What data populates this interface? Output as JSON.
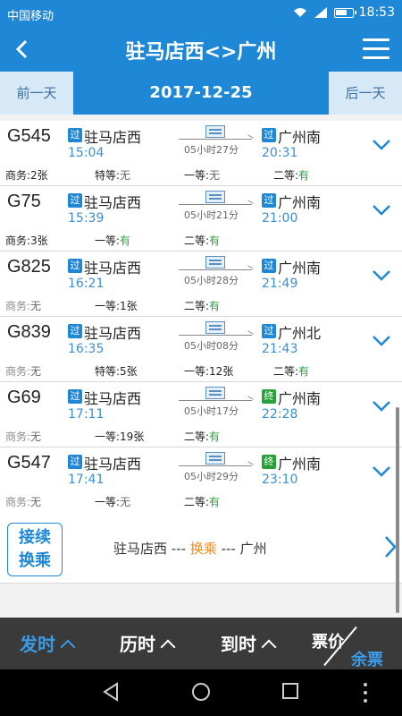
{
  "status_bar": {
    "carrier": "中国移动",
    "time": "18:53"
  },
  "header": {
    "title": "驻马店西<>广州"
  },
  "date_bar": {
    "prev_label": "前一天",
    "date": "2017-12-25",
    "next_label": "后一天"
  },
  "trains": [
    {
      "no": "G545",
      "dep_badge": "过",
      "dep_station": "驻马店西",
      "dep_time": "15:04",
      "duration": "05小时27分",
      "arr_badge": "过",
      "arr_badge_type": "pass",
      "arr_station": "广州南",
      "arr_time": "20:31",
      "seats": [
        {
          "label": "商务:",
          "value": "2张",
          "state": "count"
        },
        {
          "label": "特等:",
          "value": "无",
          "state": "none"
        },
        {
          "label": "一等:",
          "value": "无",
          "state": "none"
        },
        {
          "label": "二等:",
          "value": "有",
          "state": "avail"
        }
      ]
    },
    {
      "no": "G75",
      "dep_badge": "过",
      "dep_station": "驻马店西",
      "dep_time": "15:39",
      "duration": "05小时21分",
      "arr_badge": "过",
      "arr_badge_type": "pass",
      "arr_station": "广州南",
      "arr_time": "21:00",
      "seats": [
        {
          "label": "商务:",
          "value": "3张",
          "state": "count"
        },
        {
          "label": "一等:",
          "value": "有",
          "state": "avail"
        },
        {
          "label": "二等:",
          "value": "有",
          "state": "avail"
        },
        {
          "label": "",
          "value": "",
          "state": "none"
        }
      ]
    },
    {
      "no": "G825",
      "dep_badge": "过",
      "dep_station": "驻马店西",
      "dep_time": "16:21",
      "duration": "05小时28分",
      "arr_badge": "过",
      "arr_badge_type": "pass",
      "arr_station": "广州南",
      "arr_time": "21:49",
      "seats": [
        {
          "label": "商务:",
          "value": "无",
          "state": "none"
        },
        {
          "label": "一等:",
          "value": "1张",
          "state": "count"
        },
        {
          "label": "二等:",
          "value": "有",
          "state": "avail"
        },
        {
          "label": "",
          "value": "",
          "state": "none"
        }
      ]
    },
    {
      "no": "G839",
      "dep_badge": "过",
      "dep_station": "驻马店西",
      "dep_time": "16:35",
      "duration": "05小时08分",
      "arr_badge": "过",
      "arr_badge_type": "pass",
      "arr_station": "广州北",
      "arr_time": "21:43",
      "seats": [
        {
          "label": "商务:",
          "value": "无",
          "state": "none"
        },
        {
          "label": "特等:",
          "value": "5张",
          "state": "count"
        },
        {
          "label": "一等:",
          "value": "12张",
          "state": "count"
        },
        {
          "label": "二等:",
          "value": "有",
          "state": "avail"
        }
      ]
    },
    {
      "no": "G69",
      "dep_badge": "过",
      "dep_station": "驻马店西",
      "dep_time": "17:11",
      "duration": "05小时17分",
      "arr_badge": "终",
      "arr_badge_type": "end",
      "arr_station": "广州南",
      "arr_time": "22:28",
      "seats": [
        {
          "label": "商务:",
          "value": "无",
          "state": "none"
        },
        {
          "label": "一等:",
          "value": "19张",
          "state": "count"
        },
        {
          "label": "二等:",
          "value": "有",
          "state": "avail"
        },
        {
          "label": "",
          "value": "",
          "state": "none"
        }
      ]
    },
    {
      "no": "G547",
      "dep_badge": "过",
      "dep_station": "驻马店西",
      "dep_time": "17:41",
      "duration": "05小时29分",
      "arr_badge": "终",
      "arr_badge_type": "end",
      "arr_station": "广州南",
      "arr_time": "23:10",
      "seats": [
        {
          "label": "商务:",
          "value": "无",
          "state": "none"
        },
        {
          "label": "一等:",
          "value": "无",
          "state": "none"
        },
        {
          "label": "二等:",
          "value": "有",
          "state": "avail"
        },
        {
          "label": "",
          "value": "",
          "state": "none"
        }
      ]
    }
  ],
  "transfer": {
    "button_line1": "接续",
    "button_line2": "换乘",
    "from": "驻马店西",
    "sep1": " --- ",
    "mid": "换乘",
    "sep2": " --- ",
    "to": "广州"
  },
  "sort_bar": {
    "depart": "发时",
    "duration": "历时",
    "arrive": "到时",
    "price": "票价",
    "remaining": "余票"
  },
  "colors": {
    "primary": "#1e88d6",
    "available": "#27a23a",
    "highlight": "#f28c1b",
    "sort_active": "#3b9be8"
  }
}
